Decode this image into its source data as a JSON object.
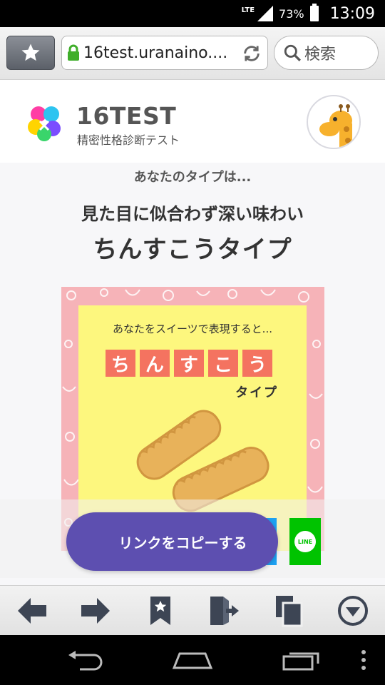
{
  "status_bar": {
    "network": "LTE",
    "battery": "73%",
    "time": "13:09"
  },
  "browser": {
    "url": "16test.uranaino....",
    "search_placeholder": "検索",
    "icons": [
      "star-icon",
      "lock-icon",
      "reload-icon",
      "search-icon"
    ]
  },
  "site": {
    "name": "16TEST",
    "tagline": "精密性格診断テスト"
  },
  "result": {
    "intro": "あなたのタイプは...",
    "subtitle": "見た目に似合わず深い味わい",
    "title": "ちんすこうタイプ",
    "card_caption": "あなたをスイーツで表現すると...",
    "card_chars": [
      "ち",
      "ん",
      "す",
      "こ",
      "う"
    ],
    "card_type": "タイプ"
  },
  "share": {
    "copy_label": "リンクをコピーする",
    "line_label": "LINE"
  },
  "colors": {
    "accent": "#5d4fb0",
    "card_bg": "#fdf77e",
    "pattern_bg": "#f6b3b8",
    "char_box": "#f47360",
    "line": "#00c300"
  },
  "bottom_toolbar": {
    "icons": [
      "back-arrow-icon",
      "forward-arrow-icon",
      "bookmark-icon",
      "exit-icon",
      "tabs-icon",
      "menu-down-icon"
    ]
  },
  "nav_bar": {
    "icons": [
      "back-icon",
      "home-icon",
      "recents-icon",
      "more-icon"
    ]
  }
}
